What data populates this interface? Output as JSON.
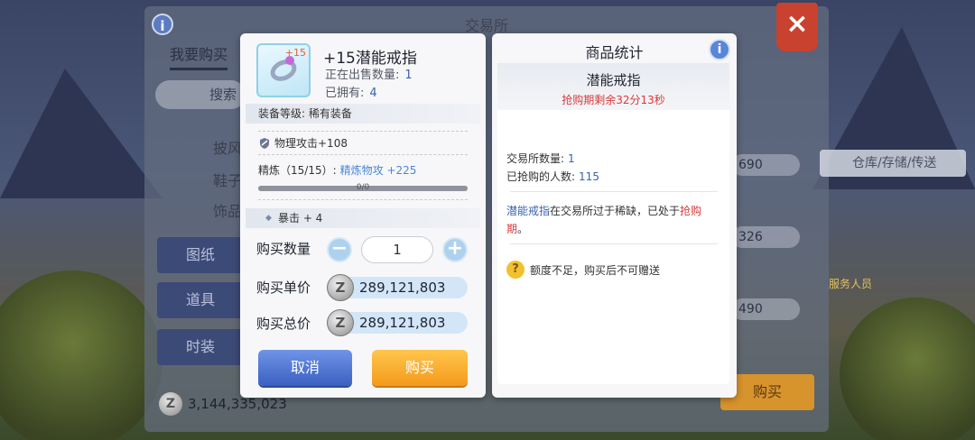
{
  "background": {
    "title": "交易所",
    "info_icon": "i",
    "close_icon": "×",
    "tab_label": "我要购买",
    "search_label": "搜索",
    "categories": [
      "披风",
      "鞋子",
      "饰品"
    ],
    "side_buttons": [
      "图纸",
      "道具",
      "时装"
    ],
    "money": "3,144,335,023",
    "prices": [
      "690",
      "326",
      "490"
    ],
    "buy_label": "购买",
    "warehouse_label": "仓库/存储/传送",
    "npc_label": "服务人员"
  },
  "buy": {
    "refine_badge": "+15",
    "item_name": "+15潜能戒指",
    "on_sale_label": "正在出售数量:",
    "on_sale_value": "1",
    "owned_label": "已拥有:",
    "owned_value": "4",
    "equip_level": "装备等级: 稀有装备",
    "attack": "物理攻击+108",
    "refine_label": "精炼（15/15）:",
    "refine_bonus": "精炼物攻 +225",
    "refine_progress_text": "0/0",
    "refine_progress": 1.0,
    "crit": "暴击 + 4",
    "qty_label": "购买数量",
    "qty_minus": "−",
    "qty_value": "1",
    "qty_plus": "+",
    "unit_price_label": "购买单价",
    "unit_price": "289,121,803",
    "total_price_label": "购买总价",
    "total_price": "289,121,803",
    "coin_symbol": "Z",
    "cancel_label": "取消",
    "buy_label": "购买"
  },
  "stats": {
    "title": "商品统计",
    "info_icon": "i",
    "item_name": "潜能戒指",
    "timer": "抢购期剩余32分13秒",
    "exchange_count_label": "交易所数量:",
    "exchange_count_value": "1",
    "buyers_label": "已抢购的人数:",
    "buyers_value": "115",
    "desc_item": "潜能戒指",
    "desc_middle": "在交易所过于稀缺，已处于",
    "desc_period": "抢购期",
    "desc_end": "。",
    "warn_icon": "?",
    "warning": "额度不足，购买后不可赠送"
  }
}
